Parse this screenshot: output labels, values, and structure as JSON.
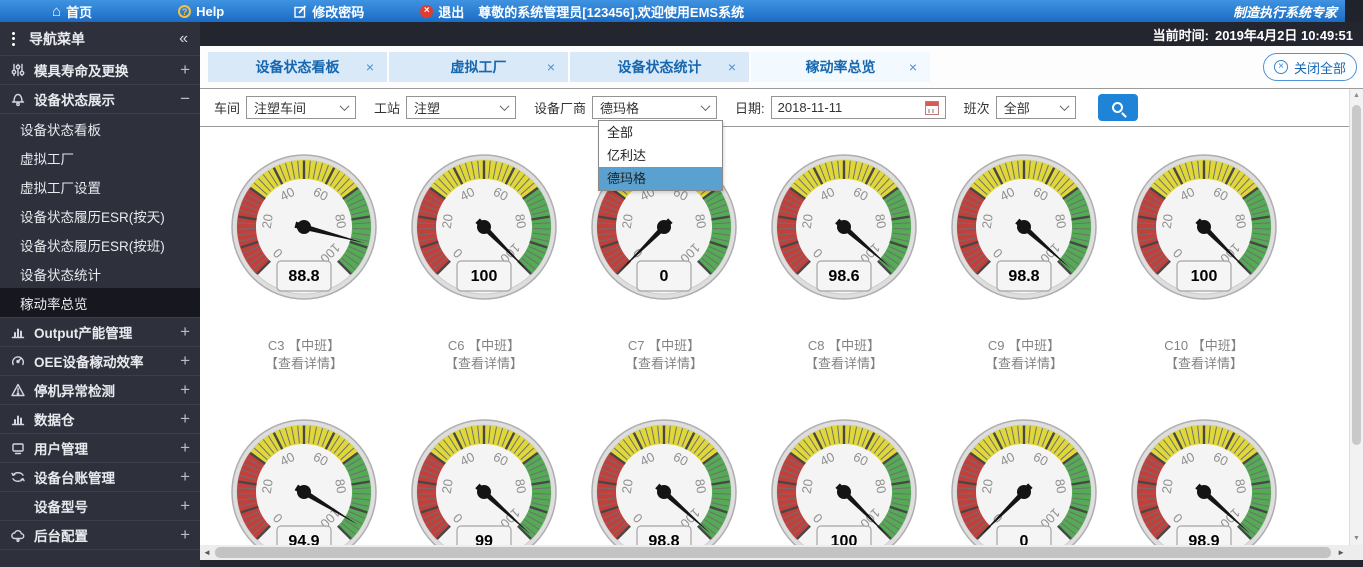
{
  "topbar": {
    "home": "首页",
    "help": "Help",
    "change_password": "修改密码",
    "logout": "退出",
    "welcome": "尊敬的系统管理员[123456],欢迎使用EMS系统",
    "brand": "制造执行系统专家"
  },
  "timebar": {
    "label": "当前时间:",
    "datetime": "2019年4月2日 10:49:51"
  },
  "sidebar": {
    "title": "导航菜单",
    "sections": [
      {
        "id": "mold-life",
        "label": "模具寿命及更换",
        "icon": "sliders",
        "state": "collapsed"
      },
      {
        "id": "equipment-status-display",
        "label": "设备状态展示",
        "icon": "bell",
        "state": "expanded",
        "selected_child": "稼动率总览",
        "children": [
          {
            "id": "status-board",
            "label": "设备状态看板"
          },
          {
            "id": "virtual-factory",
            "label": "虚拟工厂"
          },
          {
            "id": "virtual-factory-settings",
            "label": "虚拟工厂设置"
          },
          {
            "id": "status-history-esr-day",
            "label": "设备状态履历ESR(按天)"
          },
          {
            "id": "status-history-esr-shift",
            "label": "设备状态履历ESR(按班)"
          },
          {
            "id": "status-statistics",
            "label": "设备状态统计"
          },
          {
            "id": "utilization-overview",
            "label": "稼动率总览"
          }
        ]
      },
      {
        "id": "output-capacity",
        "label": "Output产能管理",
        "icon": "bar-chart",
        "state": "collapsed"
      },
      {
        "id": "oee-efficiency",
        "label": "OEE设备稼动效率",
        "icon": "gauge",
        "state": "collapsed"
      },
      {
        "id": "downtime-detection",
        "label": "停机异常检测",
        "icon": "warning",
        "state": "collapsed"
      },
      {
        "id": "data-warehouse",
        "label": "数据仓",
        "icon": "bar-chart",
        "state": "collapsed"
      },
      {
        "id": "user-management",
        "label": "用户管理",
        "icon": "monitor",
        "state": "collapsed"
      },
      {
        "id": "equipment-ledger",
        "label": "设备台账管理",
        "icon": "loop",
        "state": "collapsed"
      },
      {
        "id": "equipment-model",
        "label": "设备型号",
        "icon": "",
        "state": "collapsed"
      },
      {
        "id": "backend-config",
        "label": "后台配置",
        "icon": "cloud",
        "state": "collapsed"
      }
    ]
  },
  "tabs": {
    "items": [
      {
        "id": "status-board",
        "label": "设备状态看板",
        "active": false
      },
      {
        "id": "virtual-factory",
        "label": "虚拟工厂",
        "active": false
      },
      {
        "id": "status-statistics",
        "label": "设备状态统计",
        "active": false
      },
      {
        "id": "utilization-overview",
        "label": "稼动率总览",
        "active": true
      }
    ],
    "close_all": "关闭全部"
  },
  "filters": {
    "workshop": {
      "label": "车间",
      "value": "注塑车间"
    },
    "station": {
      "label": "工站",
      "value": "注塑"
    },
    "vendor": {
      "label": "设备厂商",
      "value": "德玛格",
      "options": [
        "全部",
        "亿利达",
        "德玛格"
      ],
      "selected_option": "德玛格"
    },
    "date": {
      "label": "日期:",
      "value": "2018-11-11"
    },
    "shift": {
      "label": "班次",
      "value": "全部"
    }
  },
  "colors": {
    "accent": "#1b75d2",
    "gauge_red": "#c2403c",
    "gauge_yellow": "#e0d83b",
    "gauge_green": "#55ab55",
    "dropdown_selected": "#5aa1d0"
  },
  "gauges": {
    "scale_labels": [
      0,
      20,
      40,
      60,
      80,
      100
    ],
    "rows": [
      {
        "items": [
          {
            "id": "c3",
            "value": "88.8",
            "label": "C3 【中班】",
            "detail": "【查看详情】"
          },
          {
            "id": "c6",
            "value": "100",
            "label": "C6 【中班】",
            "detail": "【查看详情】"
          },
          {
            "id": "c7",
            "value": "0",
            "label": "C7 【中班】",
            "detail": "【查看详情】"
          },
          {
            "id": "c8",
            "value": "98.6",
            "label": "C8 【中班】",
            "detail": "【查看详情】"
          },
          {
            "id": "c9",
            "value": "98.8",
            "label": "C9 【中班】",
            "detail": "【查看详情】"
          },
          {
            "id": "c10",
            "value": "100",
            "label": "C10 【中班】",
            "detail": "【查看详情】"
          }
        ]
      },
      {
        "items": [
          {
            "id": "r2-1",
            "value": "94.9"
          },
          {
            "id": "r2-2",
            "value": "99"
          },
          {
            "id": "r2-3",
            "value": "98.8"
          },
          {
            "id": "r2-4",
            "value": "100"
          },
          {
            "id": "r2-5",
            "value": "0"
          },
          {
            "id": "r2-6",
            "value": "98.9"
          }
        ]
      }
    ]
  }
}
